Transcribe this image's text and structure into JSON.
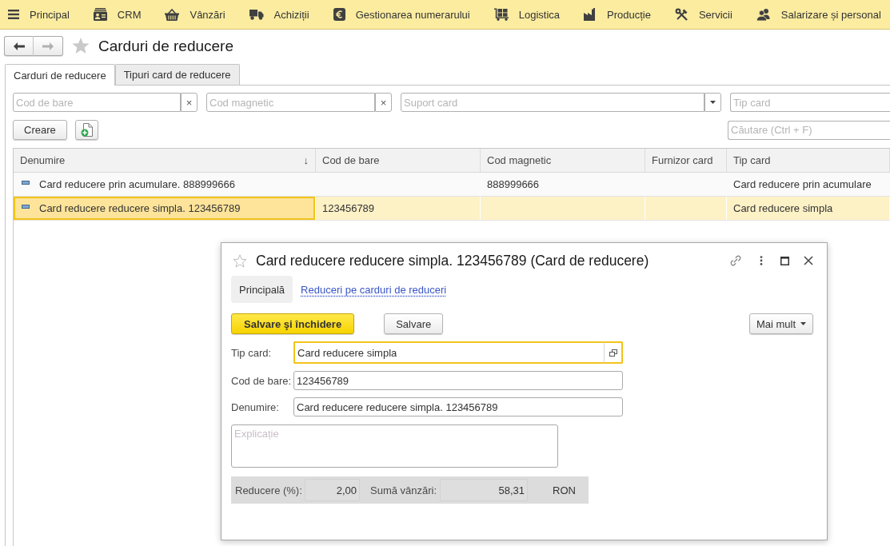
{
  "menu_bar": {
    "items": [
      {
        "label": "Principal"
      },
      {
        "label": "CRM"
      },
      {
        "label": "Vânzări"
      },
      {
        "label": "Achiziții"
      },
      {
        "label": "Gestionarea numerarului"
      },
      {
        "label": "Logistica"
      },
      {
        "label": "Producție"
      },
      {
        "label": "Servicii"
      },
      {
        "label": "Salarizare și personal"
      }
    ]
  },
  "navigation": {
    "back": {
      "disabled": false
    },
    "forward": {
      "disabled": true
    },
    "title": "Carduri de reducere"
  },
  "tabs": [
    {
      "label": "Carduri de reducere",
      "selected": true
    },
    {
      "label": "Tipuri card de reducere",
      "selected": false
    }
  ],
  "filters": [
    {
      "placeholder": "Cod de bare",
      "kind": "clearable",
      "clear": "×"
    },
    {
      "placeholder": "Cod magnetic",
      "kind": "clearable",
      "clear": "×"
    },
    {
      "placeholder": "Suport card",
      "kind": "dropdown"
    },
    {
      "placeholder": "Tip card",
      "kind": "plain"
    }
  ],
  "actions": {
    "create": "Creare",
    "search": {
      "placeholder": "Căutare (Ctrl + F)"
    }
  },
  "table": {
    "columns": [
      {
        "label": "Denumire",
        "sort_mark": "↓"
      },
      {
        "label": "Cod de bare"
      },
      {
        "label": "Cod magnetic"
      },
      {
        "label": "Furnizor card"
      },
      {
        "label": "Tip card"
      }
    ],
    "rows": [
      {
        "selected": false,
        "name": "Card reducere prin acumulare. 888999666",
        "magnetic_code": "888999666",
        "card_type": "Card reducere prin acumulare"
      },
      {
        "selected": true,
        "name": "Card reducere reducere simpla. 123456789",
        "barcode": "123456789",
        "card_type": "Card reducere simpla"
      }
    ]
  },
  "dialog": {
    "title": "Card reducere reducere simpla. 123456789 (Card de reducere)",
    "tabs": [
      {
        "label": "Principală",
        "selected": true
      },
      {
        "label": "Reduceri pe carduri de reduceri",
        "selected": false
      }
    ],
    "buttons": [
      {
        "label": "Salvare şi închidere",
        "kind": "primary"
      },
      {
        "label": "Salvare",
        "kind": "default"
      }
    ],
    "more_button": {
      "label": "Mai mult"
    },
    "fields": [
      {
        "label": "Tip card:",
        "value": "Card reducere simpla",
        "kind": "reference",
        "focused": true
      },
      {
        "label": "Cod de bare:",
        "value": "123456789",
        "kind": "text",
        "focused": false
      },
      {
        "label": "Denumire:",
        "value": "Card reducere reducere simpla. 123456789",
        "kind": "text",
        "focused": false
      }
    ],
    "comment": {
      "placeholder": "Explicație"
    },
    "summary": [
      {
        "label": "Reducere (%):",
        "value": "2,00"
      },
      {
        "label": "Sumă vânzări:",
        "value": "58,31",
        "unit": "RON"
      }
    ]
  }
}
